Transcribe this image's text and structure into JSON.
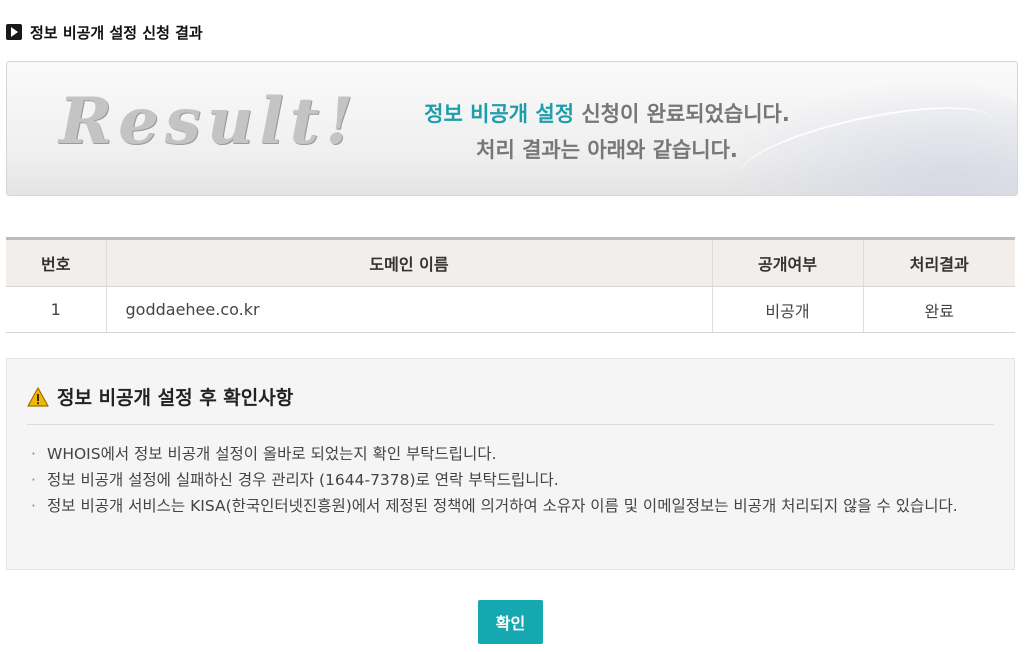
{
  "page": {
    "section_title": "정보 비공개 설정 신청 결과"
  },
  "result": {
    "logo_text": "Result!",
    "line1_accent": "정보 비공개 설정",
    "line1_rest": " 신청이 완료되었습니다.",
    "line2": "처리 결과는 아래와 같습니다.",
    "accent_color": "#1c9eab"
  },
  "table": {
    "headers": [
      "번호",
      "도메인 이름",
      "공개여부",
      "처리결과"
    ],
    "rows": [
      [
        "1",
        "goddaehee.co.kr",
        "비공개",
        "완료"
      ]
    ]
  },
  "notice": {
    "title": "정보 비공개 설정 후 확인사항",
    "icon": "warning-icon",
    "items": [
      "WHOIS에서 정보 비공개 설정이 올바로 되었는지 확인 부탁드립니다.",
      "정보 비공개 설정에 실패하신 경우 관리자 (1644-7378)로 연락 부탁드립니다.",
      "정보 비공개 서비스는 KISA(한국인터넷진흥원)에서 제정된 정책에 의거하여 소유자 이름 및 이메일정보는 비공개 처리되지 않을 수 있습니다."
    ]
  },
  "actions": {
    "confirm_label": "확인",
    "button_color": "#15a8b1"
  }
}
